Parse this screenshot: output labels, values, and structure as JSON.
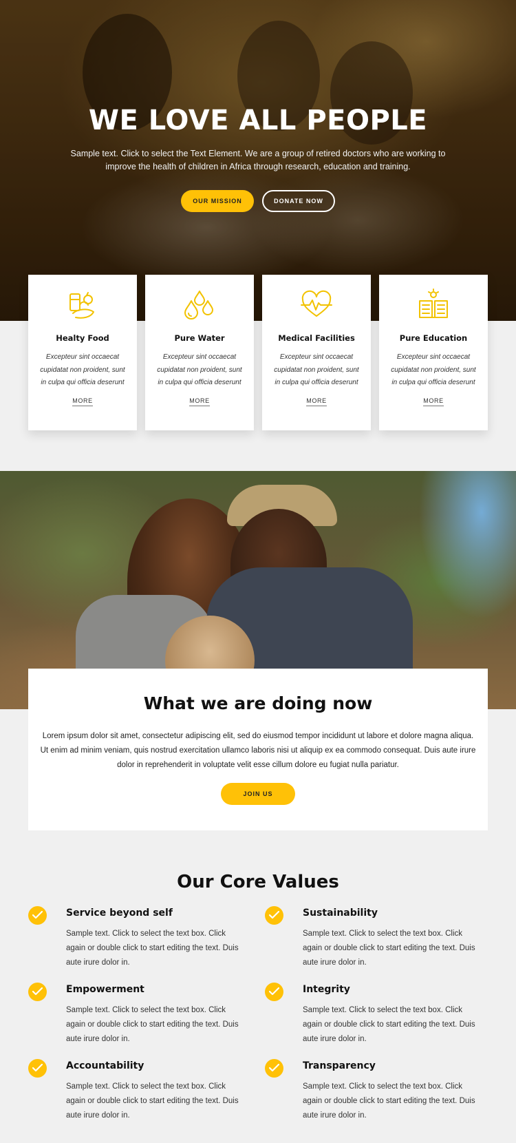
{
  "hero": {
    "title": "WE LOVE ALL PEOPLE",
    "text": "Sample text. Click to select the Text Element. We are a group of retired doctors who are working to improve the health of children in Africa through research, education and training.",
    "mission_button": "OUR MISSION",
    "donate_button": "DONATE NOW"
  },
  "features": [
    {
      "icon": "food-basket-icon",
      "title": "Healty Food",
      "text": "Excepteur sint occaecat cupidatat non proident, sunt in culpa qui officia deserunt",
      "more": "MORE"
    },
    {
      "icon": "water-drops-icon",
      "title": "Pure Water",
      "text": "Excepteur sint occaecat cupidatat non proident, sunt in culpa qui officia deserunt",
      "more": "MORE"
    },
    {
      "icon": "heartbeat-icon",
      "title": "Medical Facilities",
      "text": "Excepteur sint occaecat cupidatat non proident, sunt in culpa qui officia deserunt",
      "more": "MORE"
    },
    {
      "icon": "open-book-icon",
      "title": "Pure Education",
      "text": "Excepteur sint occaecat cupidatat non proident, sunt in culpa qui officia deserunt",
      "more": "MORE"
    }
  ],
  "doing": {
    "title": "What we are doing now",
    "text": "Lorem ipsum dolor sit amet, consectetur adipiscing elit, sed do eiusmod tempor incididunt ut labore et dolore magna aliqua. Ut enim ad minim veniam, quis nostrud exercitation ullamco laboris nisi ut aliquip ex ea commodo consequat. Duis aute irure dolor in reprehenderit in voluptate velit esse cillum dolore eu fugiat nulla pariatur.",
    "join_button": "JOIN US"
  },
  "values": {
    "title": "Our Core Values",
    "items": [
      {
        "title": "Service beyond self",
        "text": "Sample text. Click to select the text box. Click again or double click to start editing the text. Duis aute irure dolor in."
      },
      {
        "title": "Sustainability",
        "text": "Sample text. Click to select the text box. Click again or double click to start editing the text. Duis aute irure dolor in."
      },
      {
        "title": "Empowerment",
        "text": "Sample text. Click to select the text box. Click again or double click to start editing the text. Duis aute irure dolor in."
      },
      {
        "title": "Integrity",
        "text": "Sample text. Click to select the text box. Click again or double click to start editing the text. Duis aute irure dolor in."
      },
      {
        "title": "Accountability",
        "text": "Sample text. Click to select the text box. Click again or double click to start editing the text. Duis aute irure dolor in."
      },
      {
        "title": "Transparency",
        "text": "Sample text. Click to select the text box. Click again or double click to start editing the text. Duis aute irure dolor in."
      }
    ]
  },
  "colors": {
    "accent": "#ffc107",
    "background": "#f0f0f0",
    "card": "#ffffff",
    "text": "#111111"
  }
}
